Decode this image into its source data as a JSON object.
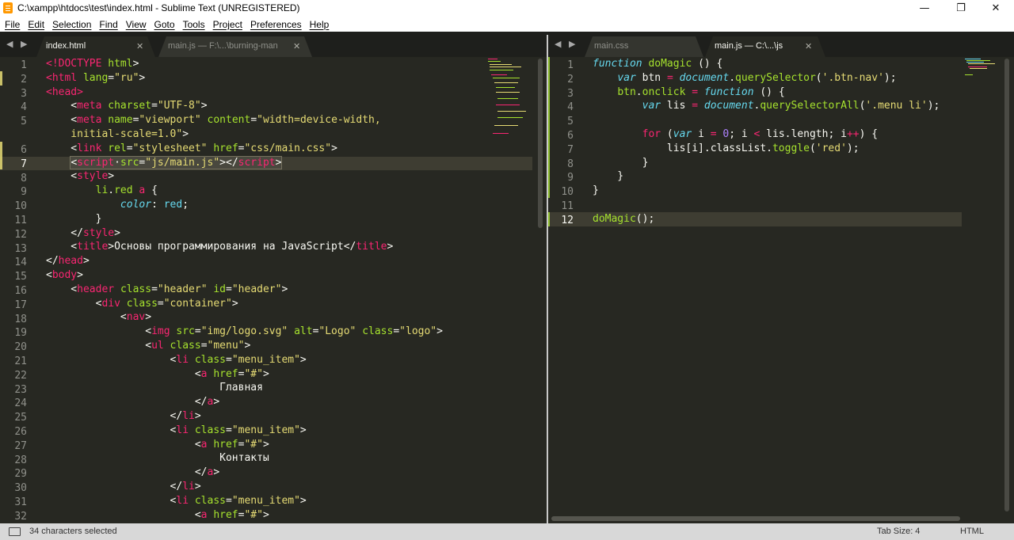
{
  "window": {
    "title": "C:\\xampp\\htdocs\\test\\index.html - Sublime Text (UNREGISTERED)",
    "controls": {
      "minimize": "—",
      "maximize": "❐",
      "close": "✕"
    }
  },
  "menu": [
    "File",
    "Edit",
    "Selection",
    "Find",
    "View",
    "Goto",
    "Tools",
    "Project",
    "Preferences",
    "Help"
  ],
  "left_pane": {
    "arrows": "◀ ▶",
    "tabs": [
      {
        "label": "index.html",
        "active": true,
        "close": "✕"
      },
      {
        "label": "main.js — F:\\...\\burning-man",
        "active": false,
        "close": "✕"
      }
    ],
    "line_numbers": [
      "1",
      "2",
      "3",
      "4",
      "5",
      "",
      "6",
      "7",
      "8",
      "9",
      "10",
      "11",
      "12",
      "13",
      "14",
      "15",
      "16",
      "17",
      "18",
      "19",
      "20",
      "21",
      "22",
      "23",
      "24",
      "25",
      "26",
      "27",
      "28",
      "29",
      "30",
      "31",
      "32"
    ],
    "current_line": "7"
  },
  "right_pane": {
    "arrows": "◀ ▶",
    "tabs": [
      {
        "label": "main.css",
        "active": false,
        "close": ""
      },
      {
        "label": "main.js — C:\\...\\js",
        "active": true,
        "close": "✕"
      }
    ],
    "line_numbers": [
      "1",
      "2",
      "3",
      "4",
      "5",
      "6",
      "7",
      "8",
      "9",
      "10",
      "11",
      "12"
    ],
    "current_line": "12"
  },
  "status": {
    "selection": "34 characters selected",
    "tab_size": "Tab Size: 4",
    "syntax": "HTML"
  },
  "colors": {
    "editor_bg": "#272822",
    "tag": "#f92672",
    "attribute": "#a6e22e",
    "string": "#e6db74",
    "keyword": "#66d9ef"
  }
}
